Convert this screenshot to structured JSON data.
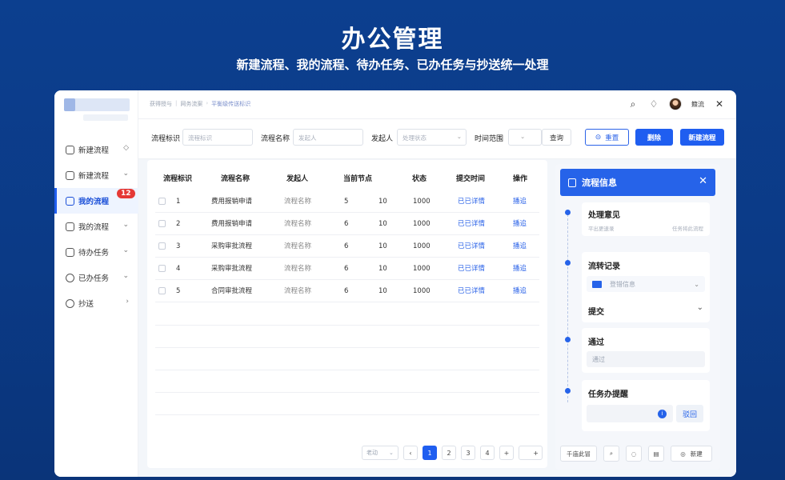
{
  "hero": {
    "title": "办公管理",
    "subtitle": "新建流程、我的流程、待办任务、已办任务与抄送统一处理"
  },
  "sidebar": {
    "items": [
      {
        "label": "新建流程",
        "icon": "home-icon",
        "chev": "◇"
      },
      {
        "label": "新建流程",
        "icon": "folder-icon",
        "chev": "⌄"
      },
      {
        "label": "我的流程",
        "icon": "flow-icon",
        "badge": "12",
        "active": true
      },
      {
        "label": "我的流程",
        "icon": "edit-doc-icon",
        "chev": "⌄"
      },
      {
        "label": "待办任务",
        "icon": "task-doc-icon",
        "chev": "⌄"
      },
      {
        "label": "已办任务",
        "icon": "compass-icon",
        "chev": "⌄"
      },
      {
        "label": "抄送",
        "icon": "clock-icon",
        "chev": "›"
      }
    ]
  },
  "topbar": {
    "crumbs": [
      "获得授与",
      "网务流案",
      "平衡级传送标识"
    ],
    "user": "籍流"
  },
  "filter": {
    "id_label": "流程标识",
    "id_placeholder": "流程标识",
    "name_label": "流程名称",
    "name_placeholder": "发起人",
    "initiator_label": "发起人",
    "initiator_placeholder": "处理状态",
    "time_label": "时间范围",
    "query": "查询",
    "reset": "重置",
    "delete": "删除",
    "new_flow": "新建流程"
  },
  "table": {
    "headers": [
      "流程标识",
      "流程名称",
      "发起人",
      "当前节点",
      "状态",
      "提交时间",
      "操作"
    ],
    "rows": [
      {
        "id": "1",
        "name": "费用报销申请",
        "initiator": "流程名称",
        "node": "5",
        "count": "10",
        "status": "1000",
        "time": "已已详情",
        "op": "播追"
      },
      {
        "id": "2",
        "name": "费用报销申请",
        "initiator": "流程名称",
        "node": "6",
        "count": "10",
        "status": "1000",
        "time": "已已详情",
        "op": "播追"
      },
      {
        "id": "3",
        "name": "采购审批流程",
        "initiator": "流程名称",
        "node": "6",
        "count": "10",
        "status": "1000",
        "time": "已已详情",
        "op": "播追"
      },
      {
        "id": "4",
        "name": "采购审批流程",
        "initiator": "流程名称",
        "node": "6",
        "count": "10",
        "status": "1000",
        "time": "已已详情",
        "op": "播追"
      },
      {
        "id": "5",
        "name": "合同审批流程",
        "initiator": "流程名称",
        "node": "6",
        "count": "10",
        "status": "1000",
        "time": "已已详情",
        "op": "播追"
      }
    ]
  },
  "pager": {
    "size_label": "老动",
    "prev": "‹",
    "pages": [
      "1",
      "2",
      "3",
      "4"
    ],
    "next": "+",
    "jump": "+"
  },
  "panel": {
    "title": "流程信息",
    "opinion_title": "处理意见",
    "opinion_hint_left": "平出更速录",
    "opinion_hint_right": "任务将此流程",
    "record_title": "流转记录",
    "record_field": "登错信息",
    "submit_title": "提交",
    "pass_title": "通过",
    "pass_field": "通过",
    "remind_title": "任务办提醒",
    "remind_button": "驳回",
    "foot_left": "千庙此冒",
    "foot_new": "新建"
  },
  "colors": {
    "primary": "#1f5ef0",
    "badge": "#e53935",
    "bg": "#0c3f8f"
  }
}
